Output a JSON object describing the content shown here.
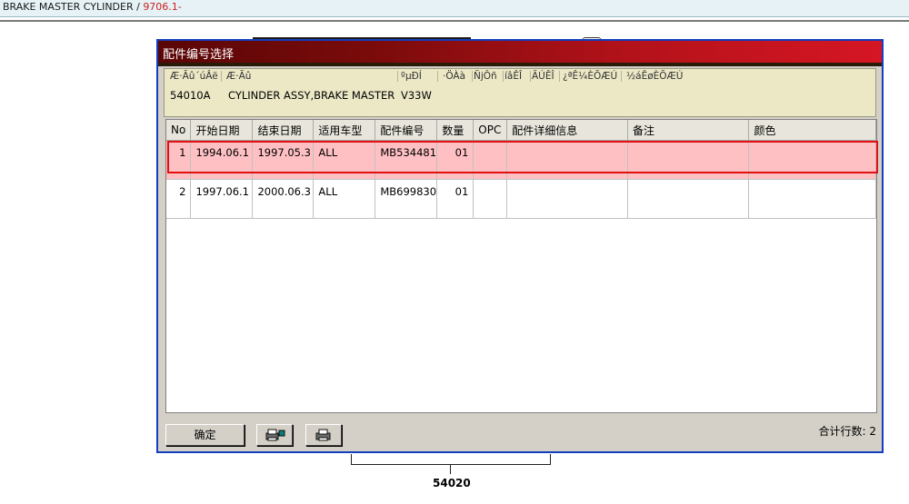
{
  "breadcrumb": {
    "path": "BRAKE MASTER CYLINDER / ",
    "code": "9706.1-"
  },
  "dialog": {
    "title": "配件编号选择",
    "info_headers": [
      "Æ·Ãû´úÂë",
      "Æ·Ãû",
      "ºµÐÍ",
      "·ÖÀà",
      "ÑjÔñ",
      "íâÊÎ",
      "ÄÚÊÎ",
      "¿ªÊ¼ÈÕÆÚ",
      "½áÊøÈÕÆÚ"
    ],
    "info_values": {
      "code": "54010A",
      "name": "CYLINDER ASSY,BRAKE MASTER",
      "model": "V33W"
    },
    "columns": [
      "No",
      "开始日期",
      "结束日期",
      "适用车型",
      "配件编号",
      "数量",
      "OPC",
      "配件详细信息",
      "备注",
      "颜色"
    ],
    "rows": [
      {
        "no": "1",
        "start": "1994.06.1",
        "end": "1997.05.3",
        "model": "ALL",
        "part": "MB534481",
        "qty": "01",
        "opc": "",
        "detail": "",
        "note": "",
        "color": ""
      },
      {
        "no": "2",
        "start": "1997.06.1",
        "end": "2000.06.3",
        "model": "ALL",
        "part": "MB699830",
        "qty": "01",
        "opc": "",
        "detail": "",
        "note": "",
        "color": ""
      }
    ],
    "ok_label": "确定",
    "row_count_label": "合计行数: 2"
  },
  "caption": "54020"
}
